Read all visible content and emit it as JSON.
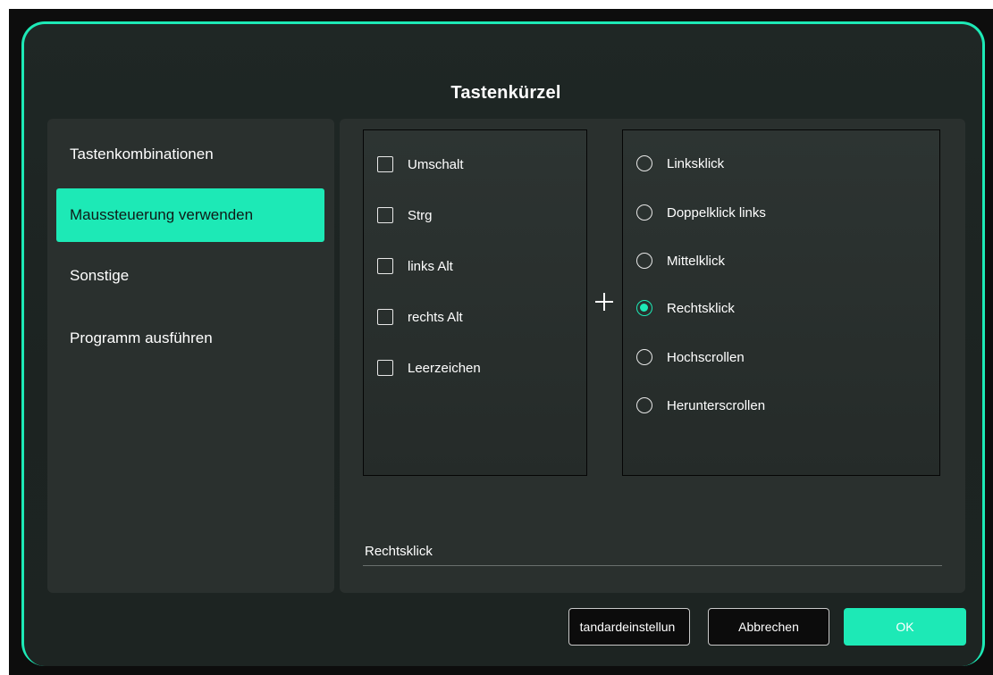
{
  "dialog": {
    "title": "Tastenkürzel",
    "accent_color": "#1de9b6"
  },
  "sidebar": {
    "items": [
      {
        "label": "Tastenkombinationen",
        "active": false
      },
      {
        "label": "Maussteuerung verwenden",
        "active": true
      },
      {
        "label": "Sonstige",
        "active": false
      },
      {
        "label": "Programm ausführen",
        "active": false
      }
    ]
  },
  "modifiers": {
    "items": [
      {
        "label": "Umschalt",
        "checked": false
      },
      {
        "label": "Strg",
        "checked": false
      },
      {
        "label": "links Alt",
        "checked": false
      },
      {
        "label": "rechts Alt",
        "checked": false
      },
      {
        "label": "Leerzeichen",
        "checked": false
      }
    ]
  },
  "plus_symbol": "+",
  "mouse_actions": {
    "selected": "Rechtsklick",
    "items": [
      {
        "label": "Linksklick"
      },
      {
        "label": "Doppelklick links"
      },
      {
        "label": "Mittelklick"
      },
      {
        "label": "Rechtsklick"
      },
      {
        "label": "Hochscrollen"
      },
      {
        "label": "Herunterscrollen"
      }
    ]
  },
  "result": {
    "value": "Rechtsklick"
  },
  "buttons": {
    "default_label": "tandardeinstellun",
    "cancel_label": "Abbrechen",
    "ok_label": "OK"
  }
}
